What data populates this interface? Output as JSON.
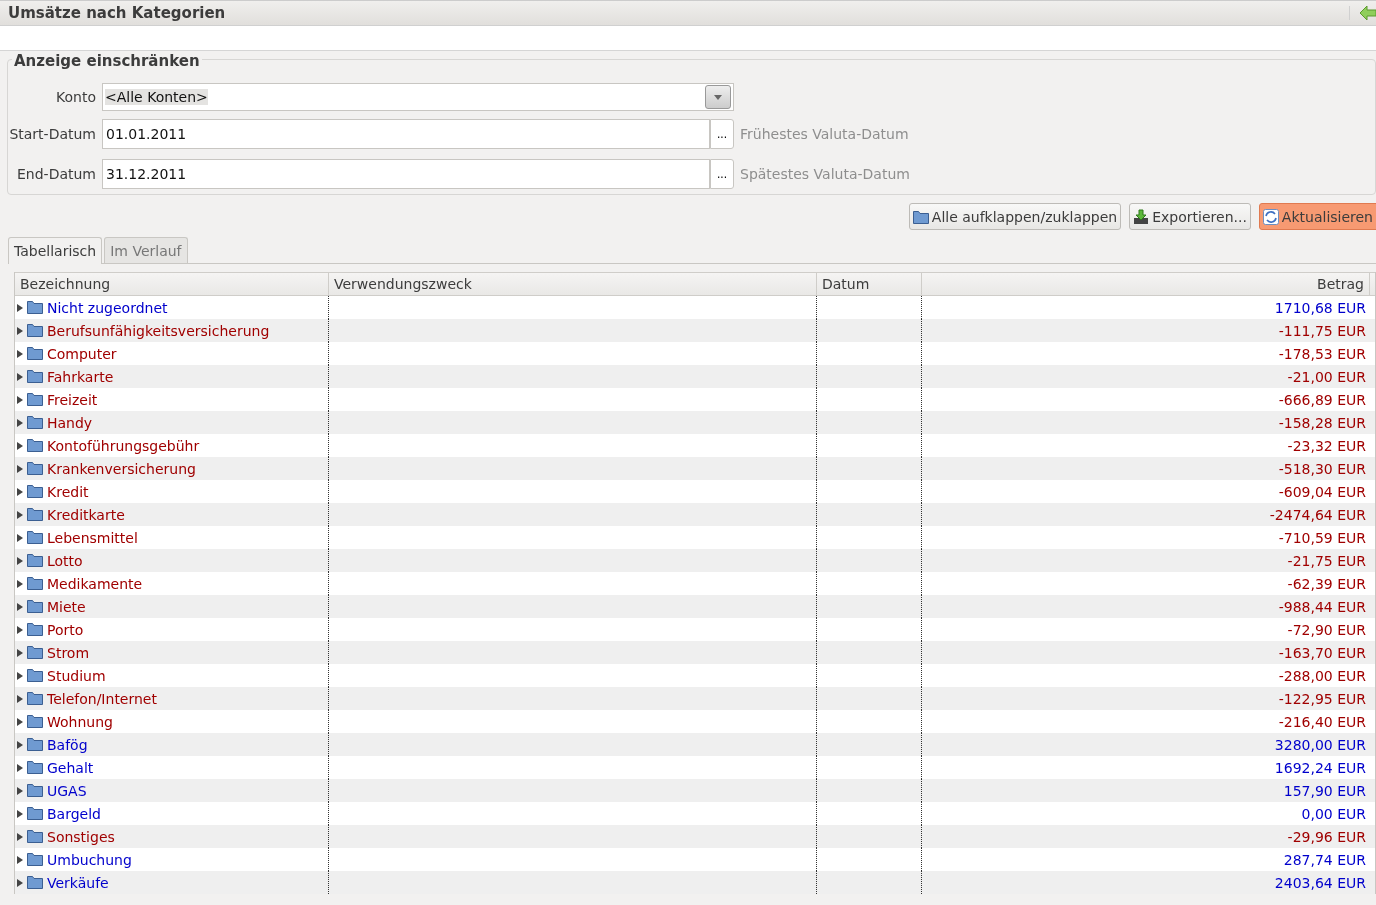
{
  "window": {
    "title": "Umsätze nach Kategorien"
  },
  "filter": {
    "title": "Anzeige einschränken",
    "konto": {
      "label": "Konto",
      "value": "<Alle Konten>"
    },
    "start": {
      "label": "Start-Datum",
      "value": "01.01.2011",
      "button": "...",
      "hint": "Frühestes Valuta-Datum"
    },
    "end": {
      "label": "End-Datum",
      "value": "31.12.2011",
      "button": "...",
      "hint": "Spätestes Valuta-Datum"
    }
  },
  "buttons": [
    {
      "label": "Alle aufklappen/zuklappen",
      "kind": "folder"
    },
    {
      "label": "Exportieren...",
      "kind": "export"
    },
    {
      "label": "Aktualisieren",
      "kind": "refresh"
    }
  ],
  "tabs": [
    {
      "label": "Tabellarisch",
      "selected": true
    },
    {
      "label": "Im Verlauf",
      "selected": false
    }
  ],
  "table": {
    "columns": [
      "Bezeichnung",
      "Verwendungszweck",
      "Datum",
      "Betrag"
    ],
    "rows": [
      {
        "name": "Nicht zugeordnet",
        "amount": "1710,68 EUR",
        "color": "#0000cc"
      },
      {
        "name": "Berufsunfähigkeitsversicherung",
        "amount": "-111,75 EUR",
        "color": "#a00000"
      },
      {
        "name": "Computer",
        "amount": "-178,53 EUR",
        "color": "#a00000"
      },
      {
        "name": "Fahrkarte",
        "amount": "-21,00 EUR",
        "color": "#a00000"
      },
      {
        "name": "Freizeit",
        "amount": "-666,89 EUR",
        "color": "#a00000"
      },
      {
        "name": "Handy",
        "amount": "-158,28 EUR",
        "color": "#a00000"
      },
      {
        "name": "Kontoführungsgebühr",
        "amount": "-23,32 EUR",
        "color": "#a00000"
      },
      {
        "name": "Krankenversicherung",
        "amount": "-518,30 EUR",
        "color": "#a00000"
      },
      {
        "name": "Kredit",
        "amount": "-609,04 EUR",
        "color": "#a00000"
      },
      {
        "name": "Kreditkarte",
        "amount": "-2474,64 EUR",
        "color": "#a00000"
      },
      {
        "name": "Lebensmittel",
        "amount": "-710,59 EUR",
        "color": "#a00000"
      },
      {
        "name": "Lotto",
        "amount": "-21,75 EUR",
        "color": "#a00000"
      },
      {
        "name": "Medikamente",
        "amount": "-62,39 EUR",
        "color": "#a00000"
      },
      {
        "name": "Miete",
        "amount": "-988,44 EUR",
        "color": "#a00000"
      },
      {
        "name": "Porto",
        "amount": "-72,90 EUR",
        "color": "#a00000"
      },
      {
        "name": "Strom",
        "amount": "-163,70 EUR",
        "color": "#a00000"
      },
      {
        "name": "Studium",
        "amount": "-288,00 EUR",
        "color": "#a00000"
      },
      {
        "name": "Telefon/Internet",
        "amount": "-122,95 EUR",
        "color": "#a00000"
      },
      {
        "name": "Wohnung",
        "amount": "-216,40 EUR",
        "color": "#a00000"
      },
      {
        "name": "Bafög",
        "amount": "3280,00 EUR",
        "color": "#0000cc"
      },
      {
        "name": "Gehalt",
        "amount": "1692,24 EUR",
        "color": "#0000cc"
      },
      {
        "name": "UGAS",
        "amount": "157,90 EUR",
        "color": "#0000cc"
      },
      {
        "name": "Bargeld",
        "amount": "0,00 EUR",
        "color": "#0000cc"
      },
      {
        "name": "Sonstiges",
        "amount": "-29,96 EUR",
        "color": "#a00000"
      },
      {
        "name": "Umbuchung",
        "amount": "287,74 EUR",
        "color": "#0000cc"
      },
      {
        "name": "Verkäufe",
        "amount": "2403,64 EUR",
        "color": "#0000cc"
      }
    ]
  }
}
